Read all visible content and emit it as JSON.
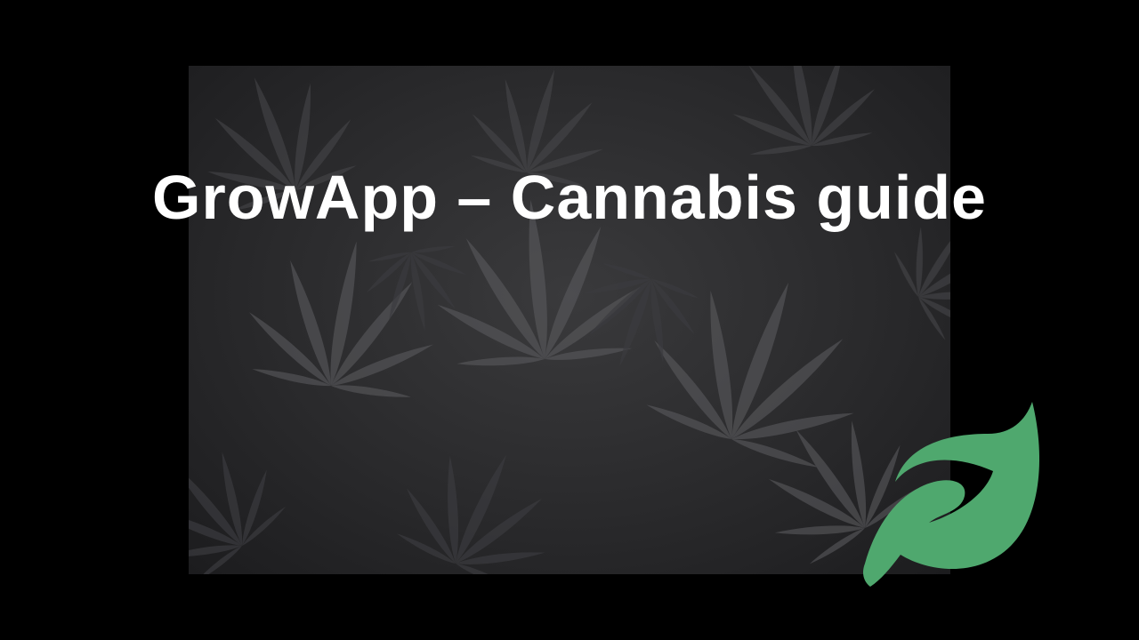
{
  "slide": {
    "title": "GrowApp – Cannabis guide"
  },
  "background_image": {
    "subject": "cannabis leaves, desaturated dark photo"
  },
  "logo": {
    "icon": "leaf-icon",
    "color": "#4fa86e"
  },
  "colors": {
    "background": "#000000",
    "title_text": "#ffffff"
  }
}
